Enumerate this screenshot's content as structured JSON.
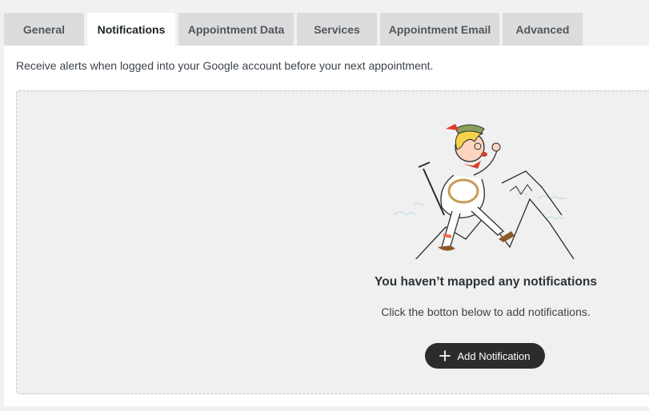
{
  "tabs": [
    {
      "label": "General",
      "active": false
    },
    {
      "label": "Notifications",
      "active": true
    },
    {
      "label": "Appointment Data",
      "active": false
    },
    {
      "label": "Services",
      "active": false
    },
    {
      "label": "Appointment Email",
      "active": false
    },
    {
      "label": "Advanced",
      "active": false
    }
  ],
  "notifications": {
    "intro": "Receive alerts when logged into your Google account before your next appointment.",
    "empty_state": {
      "illustration": "mountain-climber-yodeling",
      "title": "You haven’t mapped any notifications",
      "text": "Click the botton below to add notifications.",
      "button": {
        "label": "Add Notification",
        "icon": "plus-icon"
      }
    }
  },
  "colors": {
    "active_tab": "#ffffff",
    "inactive_tab": "#dcdcdc",
    "button_bg": "#2c2c2c",
    "empty_box_bg": "#f0f0f0"
  }
}
